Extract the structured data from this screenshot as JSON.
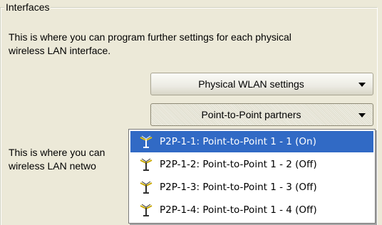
{
  "group": {
    "title": "Interfaces"
  },
  "section1": {
    "line1": "This is where you can program further settings for each physical",
    "line2": "wireless LAN interface."
  },
  "section2": {
    "line1": "This is where you can",
    "line2": "wireless LAN netwo"
  },
  "buttons": {
    "physical_wlan": "Physical WLAN settings",
    "p2p_partners": "Point-to-Point partners"
  },
  "menu": {
    "items": [
      {
        "label": "P2P-1-1: Point-to-Point 1 - 1 (On)",
        "selected": true,
        "icon": "wlan-antenna-icon"
      },
      {
        "label": "P2P-1-2: Point-to-Point 1 - 2 (Off)",
        "selected": false,
        "icon": "wlan-antenna-icon"
      },
      {
        "label": "P2P-1-3: Point-to-Point 1 - 3 (Off)",
        "selected": false,
        "icon": "wlan-antenna-icon"
      },
      {
        "label": "P2P-1-4: Point-to-Point 1 - 4 (Off)",
        "selected": false,
        "icon": "wlan-antenna-icon"
      }
    ]
  },
  "colors": {
    "selection": "#316ac5",
    "window": "#ece9d8"
  }
}
